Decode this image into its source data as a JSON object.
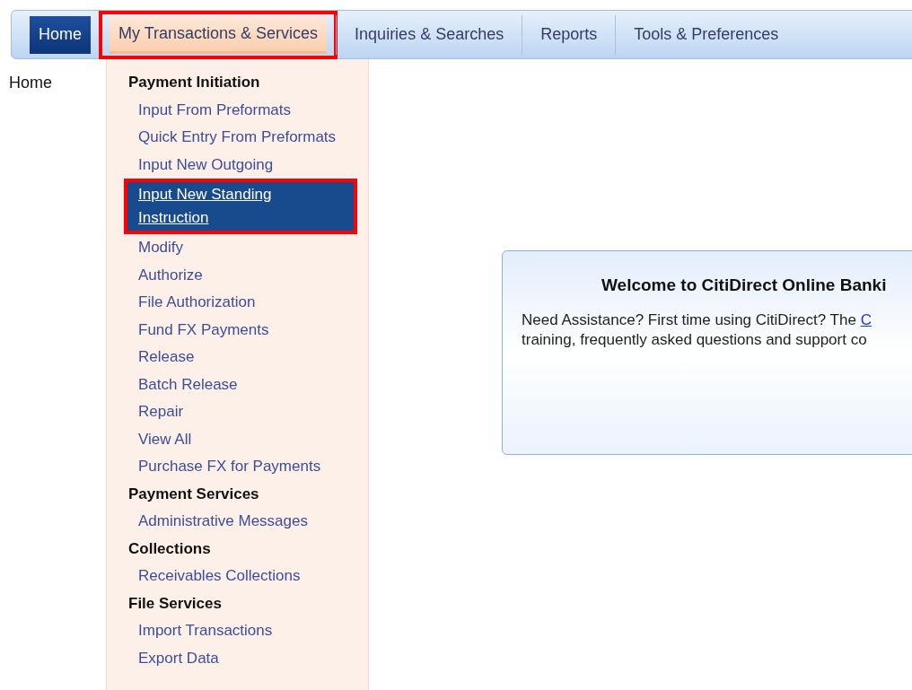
{
  "nav": {
    "tabs": [
      {
        "label": "Home",
        "selected": true,
        "open": false,
        "annotated": false
      },
      {
        "label": "My Transactions & Services",
        "selected": false,
        "open": true,
        "annotated": true
      },
      {
        "label": "Inquiries & Searches",
        "selected": false,
        "open": false,
        "annotated": false
      },
      {
        "label": "Reports",
        "selected": false,
        "open": false,
        "annotated": false
      },
      {
        "label": "Tools & Preferences",
        "selected": false,
        "open": false,
        "annotated": false
      }
    ]
  },
  "breadcrumb": "Home",
  "menu": {
    "groups": [
      {
        "heading": "Payment Initiation",
        "items": [
          {
            "label": "Input From Preformats",
            "highlighted": false,
            "annotated": false
          },
          {
            "label": "Quick Entry From Preformats",
            "highlighted": false,
            "annotated": false
          },
          {
            "label": "Input New Outgoing",
            "highlighted": false,
            "annotated": false
          },
          {
            "label": "Input New Standing Instruction",
            "highlighted": true,
            "annotated": true
          },
          {
            "label": "Modify",
            "highlighted": false,
            "annotated": false
          },
          {
            "label": "Authorize",
            "highlighted": false,
            "annotated": false
          },
          {
            "label": "File Authorization",
            "highlighted": false,
            "annotated": false
          },
          {
            "label": "Fund FX Payments",
            "highlighted": false,
            "annotated": false
          },
          {
            "label": "Release",
            "highlighted": false,
            "annotated": false
          },
          {
            "label": "Batch Release",
            "highlighted": false,
            "annotated": false
          },
          {
            "label": "Repair",
            "highlighted": false,
            "annotated": false
          },
          {
            "label": "View All",
            "highlighted": false,
            "annotated": false
          },
          {
            "label": "Purchase FX for Payments",
            "highlighted": false,
            "annotated": false
          }
        ]
      },
      {
        "heading": "Payment Services",
        "items": [
          {
            "label": "Administrative Messages",
            "highlighted": false,
            "annotated": false
          }
        ]
      },
      {
        "heading": "Collections",
        "items": [
          {
            "label": "Receivables Collections",
            "highlighted": false,
            "annotated": false
          }
        ]
      },
      {
        "heading": "File Services",
        "items": [
          {
            "label": "Import Transactions",
            "highlighted": false,
            "annotated": false
          },
          {
            "label": "Export Data",
            "highlighted": false,
            "annotated": false
          }
        ]
      }
    ]
  },
  "welcome": {
    "title": "Welcome to CitiDirect Online Banki",
    "line_1": "Need Assistance? First time using CitiDirect? The ",
    "link": "C",
    "line_2": "training, frequently asked questions and support co"
  }
}
